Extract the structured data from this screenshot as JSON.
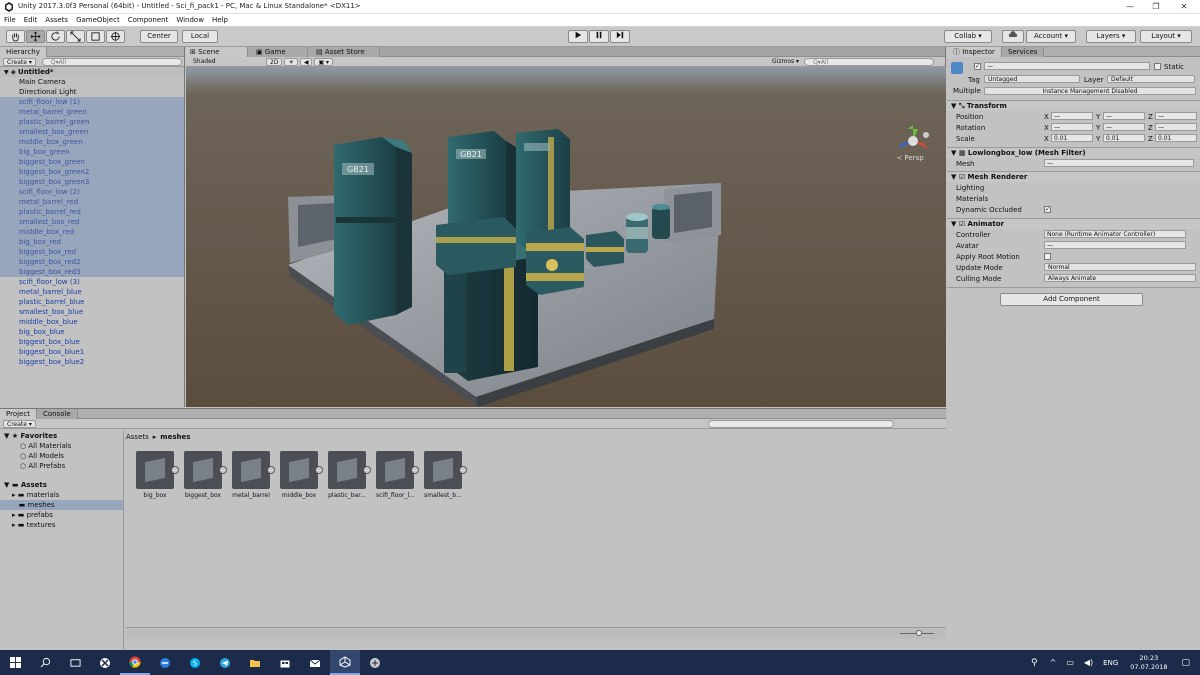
{
  "window": {
    "title": "Unity 2017.3.0f3 Personal (64bit) - Untitled - Sci_fi_pack1 - PC, Mac & Linux Standalone* <DX11>"
  },
  "menu": [
    "File",
    "Edit",
    "Assets",
    "GameObject",
    "Component",
    "Window",
    "Help"
  ],
  "toolbar": {
    "pivot": "Center",
    "space": "Local",
    "collab": "Collab ▾",
    "account": "Account",
    "layers": "Layers",
    "layout": "Layout"
  },
  "hierarchy": {
    "tab": "Hierarchy",
    "create": "Create",
    "search_placeholder": "Q▾All",
    "scene_name": "Untitled*",
    "items": [
      {
        "label": "Main Camera",
        "style": "black"
      },
      {
        "label": "Directional Light",
        "style": "black"
      },
      {
        "label": "scifi_floor_low (1)",
        "style": "sel"
      },
      {
        "label": "metal_barrel_green",
        "style": "sel"
      },
      {
        "label": "plastic_barrel_green",
        "style": "sel"
      },
      {
        "label": "smallest_box_green",
        "style": "sel"
      },
      {
        "label": "middle_box_green",
        "style": "sel"
      },
      {
        "label": "big_box_green",
        "style": "sel"
      },
      {
        "label": "biggest_box_green",
        "style": "sel"
      },
      {
        "label": "biggest_box_green2",
        "style": "sel"
      },
      {
        "label": "biggest_box_green3",
        "style": "sel"
      },
      {
        "label": "scifi_floor_low (2)",
        "style": "sel"
      },
      {
        "label": "metal_barrel_red",
        "style": "sel"
      },
      {
        "label": "plastic_barrel_red",
        "style": "sel"
      },
      {
        "label": "smallest_box_red",
        "style": "sel"
      },
      {
        "label": "middle_box_red",
        "style": "sel"
      },
      {
        "label": "big_box_red",
        "style": "sel"
      },
      {
        "label": "biggest_box_red",
        "style": "sel"
      },
      {
        "label": "biggest_box_red2",
        "style": "sel"
      },
      {
        "label": "biggest_box_red3",
        "style": "sel"
      },
      {
        "label": "scifi_floor_low (3)",
        "style": "blue"
      },
      {
        "label": "metal_barrel_blue",
        "style": "blue"
      },
      {
        "label": "plastic_barrel_blue",
        "style": "blue"
      },
      {
        "label": "smallest_box_blue",
        "style": "blue"
      },
      {
        "label": "middle_box_blue",
        "style": "blue"
      },
      {
        "label": "big_box_blue",
        "style": "blue"
      },
      {
        "label": "biggest_box_blue",
        "style": "blue"
      },
      {
        "label": "biggest_box_blue1",
        "style": "blue"
      },
      {
        "label": "biggest_box_blue2",
        "style": "blue"
      }
    ]
  },
  "scene": {
    "tabs": [
      "Scene",
      "Game",
      "Asset Store"
    ],
    "shading": "Shaded",
    "mode2d": "2D",
    "gizmos": "Gizmos ▾",
    "search_placeholder": "Q▾All",
    "persp": "≺ Persp",
    "box_label": "GB21"
  },
  "inspector": {
    "tabs": [
      "Inspector",
      "Services"
    ],
    "static": "Static",
    "tag_label": "Tag",
    "tag": "Untagged",
    "layer_label": "Layer",
    "layer": "Default",
    "multiple_label": "Multiple",
    "multiple_value": "Instance Management Disabled",
    "transform": {
      "title": "Transform",
      "position": "Position",
      "rotation": "Rotation",
      "scale": "Scale",
      "dash": "—",
      "scale_x": "0.01",
      "scale_y": "0.01",
      "scale_z": "0.01"
    },
    "mesh_filter": {
      "title": "Lowlongbox_low (Mesh Filter)",
      "mesh": "Mesh",
      "mesh_value": "—"
    },
    "mesh_renderer": {
      "title": "Mesh Renderer",
      "lighting": "Lighting",
      "materials": "Materials",
      "dynamic": "Dynamic Occluded"
    },
    "animator": {
      "title": "Animator",
      "controller": "Controller",
      "controller_value": "None (Runtime Animator Controller)",
      "avatar": "Avatar",
      "avatar_value": "—",
      "root": "Apply Root Motion",
      "update": "Update Mode",
      "update_value": "Normal",
      "culling": "Culling Mode",
      "culling_value": "Always Animate"
    },
    "add_component": "Add Component"
  },
  "project": {
    "tabs": [
      "Project",
      "Console"
    ],
    "create": "Create",
    "favorites": "Favorites",
    "fav_items": [
      "All Materials",
      "All Models",
      "All Prefabs"
    ],
    "assets": "Assets",
    "folders": [
      "materials",
      "meshes",
      "prefabs",
      "textures"
    ],
    "breadcrumb": [
      "Assets",
      "meshes"
    ],
    "meshes": [
      "big_box",
      "biggest_box",
      "metal_barrel",
      "middle_box",
      "plastic_bar...",
      "scifi_floor_l...",
      "smallest_b..."
    ]
  },
  "taskbar": {
    "lang": "ENG",
    "time": "20:23",
    "date": "07.07.2018"
  }
}
